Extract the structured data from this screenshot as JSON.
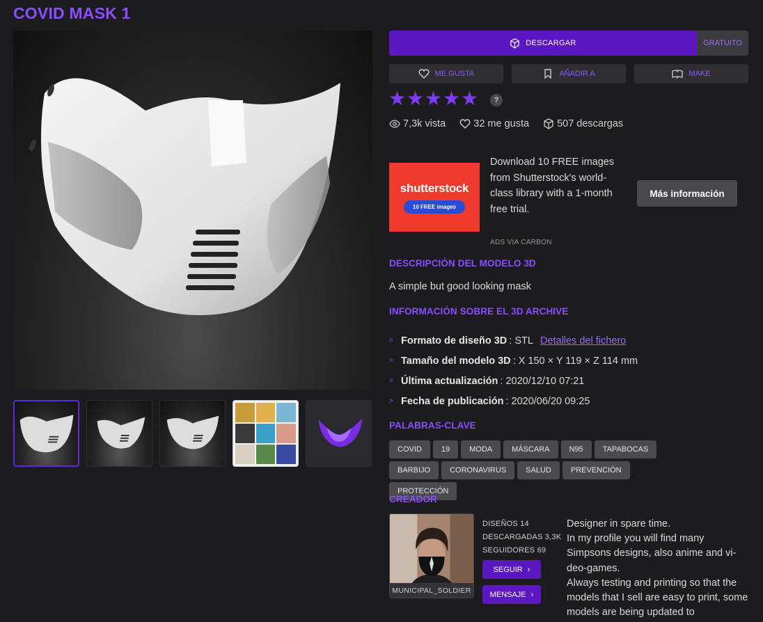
{
  "page": {
    "title": "COVID MASK 1"
  },
  "download": {
    "label": "DESCARGAR",
    "price": "GRATUITO"
  },
  "actions": {
    "like": "ME GUSTA",
    "add": "AÑADIR A",
    "make": "MAKE"
  },
  "rating": {
    "stars": 5,
    "max": 5,
    "help": "?"
  },
  "stats": {
    "views": "7,3k vista",
    "likes": "32 me gusta",
    "downloads": "507 descargas"
  },
  "ad": {
    "logo": "shutterstock",
    "pill": "10 FREE images",
    "text": "Download 10 FREE images from Shutterstock's world-class library with a 1-month free trial.",
    "button": "Más información",
    "via": "ADS VIA CARBON"
  },
  "description": {
    "heading": "DESCRIPCIÓN DEL MODELO 3D",
    "text": "A simple but good looking mask"
  },
  "info": {
    "heading": "INFORMACIÓN SOBRE EL 3D ARCHIVE",
    "format_label": "Formato de diseño 3D",
    "format_value": ": STL",
    "format_link": "Detalles del fichero",
    "size_label": "Tamaño del modelo 3D",
    "size_value": ": X 150 × Y 119 × Z 114 mm",
    "updated_label": "Última actualización",
    "updated_value": ": 2020/12/10 07:21",
    "published_label": "Fecha de publicación",
    "published_value": ": 2020/06/20 09:25"
  },
  "keywords": {
    "heading": "PALABRAS-CLAVE",
    "tags": [
      "COVID",
      "19",
      "MODA",
      "MÁSCARA",
      "N95",
      "TAPABOCAS",
      "BARBIJO",
      "CORONAVIRUS",
      "SALUD",
      "PREVENCIÓN",
      "PROTECCIÓN"
    ]
  },
  "creator": {
    "heading": "CREADOR",
    "name": "MUNICIPAL_SOLDIER",
    "designs": "DISEÑOS 14",
    "downloaded": "DESCARGADAS 3,3K",
    "followers": "SEGUIDORES 69",
    "follow": "SEGUIR",
    "message": "MENSAJE",
    "bio": [
      "Designer in spare time.",
      "In my profile you will find many Simpsons designs, also anime and vi-deo-games.",
      "Always testing and printing so that the models that I sell are easy to print, some models are being updated to"
    ]
  },
  "colors": {
    "accent": "#8a4dff",
    "button": "#5a17c2",
    "background": "#1c1c1f"
  }
}
